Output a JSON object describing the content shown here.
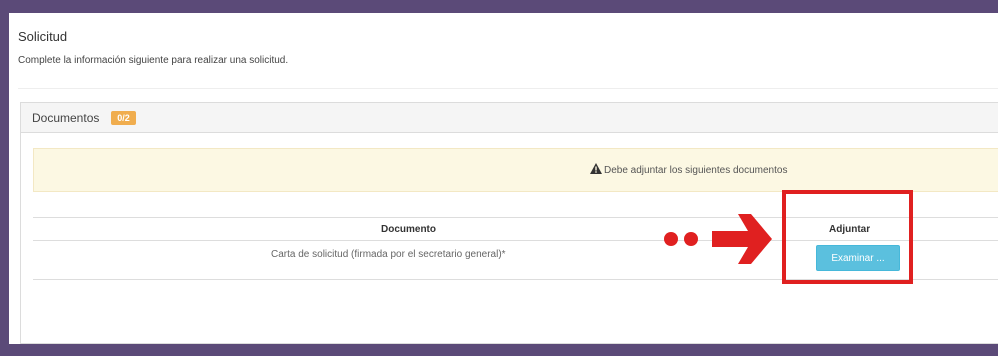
{
  "page": {
    "title": "Solicitud",
    "subtitle": "Complete la información siguiente para realizar una solicitud."
  },
  "panel": {
    "heading": "Documentos",
    "badge": "0/2"
  },
  "alert": {
    "icon": "warning-icon",
    "text": "Debe adjuntar los siguientes documentos"
  },
  "table": {
    "columns": [
      "Documento",
      "Adjuntar"
    ],
    "rows": [
      {
        "documento": "Carta de solicitud (firmada por el secretario general)*",
        "adjuntar": "Examinar ..."
      }
    ]
  },
  "annotation": {
    "color": "#e02020",
    "arrow": "red-dotted-arrow-icon"
  },
  "colors": {
    "frame": "#5b4a78",
    "badge": "#f0ad4e",
    "button": "#5bc0de",
    "alert_bg": "#fcf8e3"
  }
}
